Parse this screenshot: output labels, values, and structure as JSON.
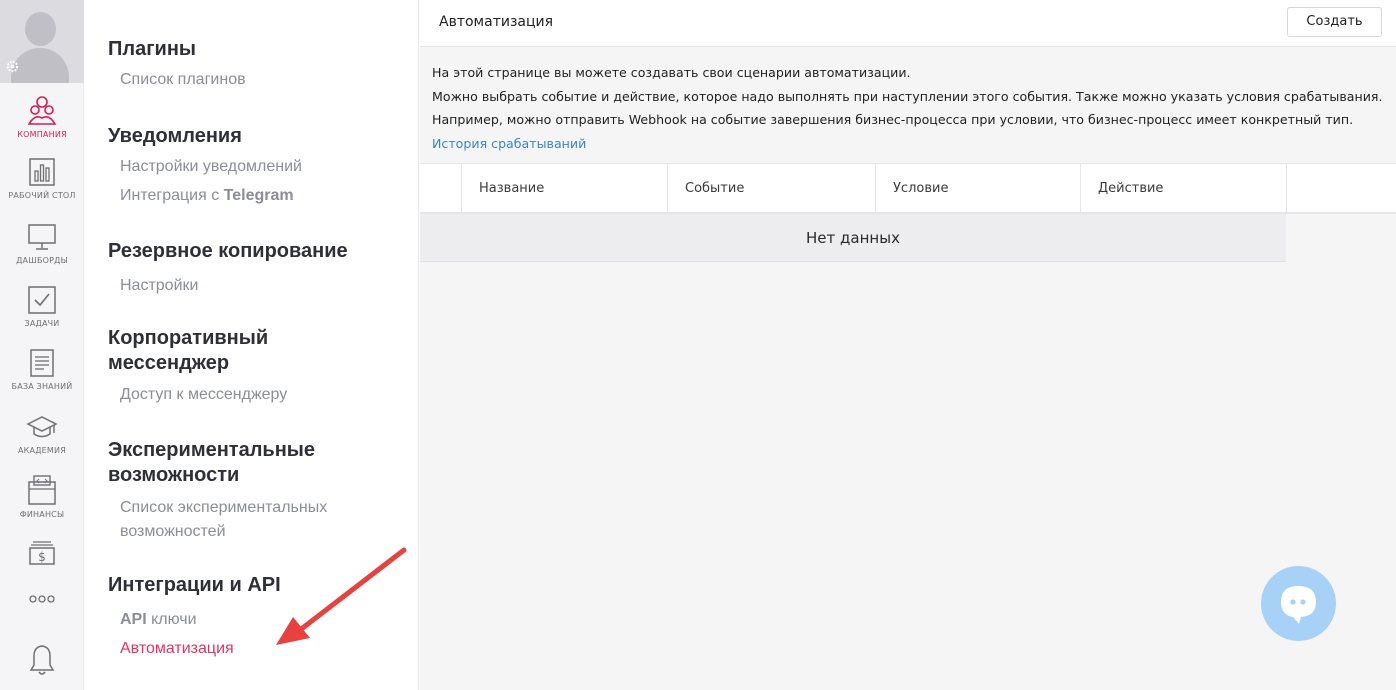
{
  "rail": {
    "items": [
      {
        "id": "company",
        "label": "КОМПАНИЯ",
        "icon": "company-icon",
        "active": true
      },
      {
        "id": "desktop",
        "label": "РАБОЧИЙ СТОЛ",
        "icon": "bar-chart-icon"
      },
      {
        "id": "dashboards",
        "label": "ДАШБОРДЫ",
        "icon": "monitor-icon"
      },
      {
        "id": "tasks",
        "label": "ЗАДАЧИ",
        "icon": "checkbox-icon"
      },
      {
        "id": "knowledge",
        "label": "БАЗА ЗНАНИЙ",
        "icon": "document-icon"
      },
      {
        "id": "academy",
        "label": "АКАДЕМИЯ",
        "icon": "graduation-cap-icon"
      },
      {
        "id": "finance",
        "label": "ФИНАНСЫ",
        "icon": "wallet-icon"
      }
    ]
  },
  "menu": {
    "plugins": {
      "title": "Плагины",
      "links": [
        "Список плагинов"
      ]
    },
    "notifications": {
      "title": "Уведомления",
      "link1": "Настройки уведомлений",
      "link2_prefix": "Интеграция с ",
      "link2_bold": "Telegram"
    },
    "backup": {
      "title": "Резервное копирование",
      "links": [
        "Настройки"
      ]
    },
    "messenger": {
      "title_line1": "Корпоративный",
      "title_line2": "мессенджер",
      "links": [
        "Доступ к мессенджеру"
      ]
    },
    "experimental": {
      "title_line1": "Экспериментальные",
      "title_line2": "возможности",
      "link_line1": "Список экспериментальных",
      "link_line2": "возможностей"
    },
    "integrations": {
      "title": "Интеграции и API",
      "link1_bold": "API",
      "link1_rest": " ключи",
      "link2": "Автоматизация"
    }
  },
  "main": {
    "title": "Автоматизация",
    "create_label": "Создать",
    "desc": [
      "На этой странице вы можете создавать свои сценарии автоматизации.",
      "Можно выбрать событие и действие, которое надо выполнять при наступлении этого события. Также можно указать условия срабатывания.",
      "Например, можно отправить Webhook на событие завершения бизнес-процесса при условии, что бизнес-процесс имеет конкретный тип."
    ],
    "history_link": "История срабатываний",
    "columns": [
      "Название",
      "Событие",
      "Условие",
      "Действие"
    ],
    "empty_text": "Нет данных"
  },
  "colors": {
    "accent": "#e5335f",
    "link": "#3b83c4",
    "chat": "#a8d1f7",
    "arrow": "#e8423f"
  }
}
